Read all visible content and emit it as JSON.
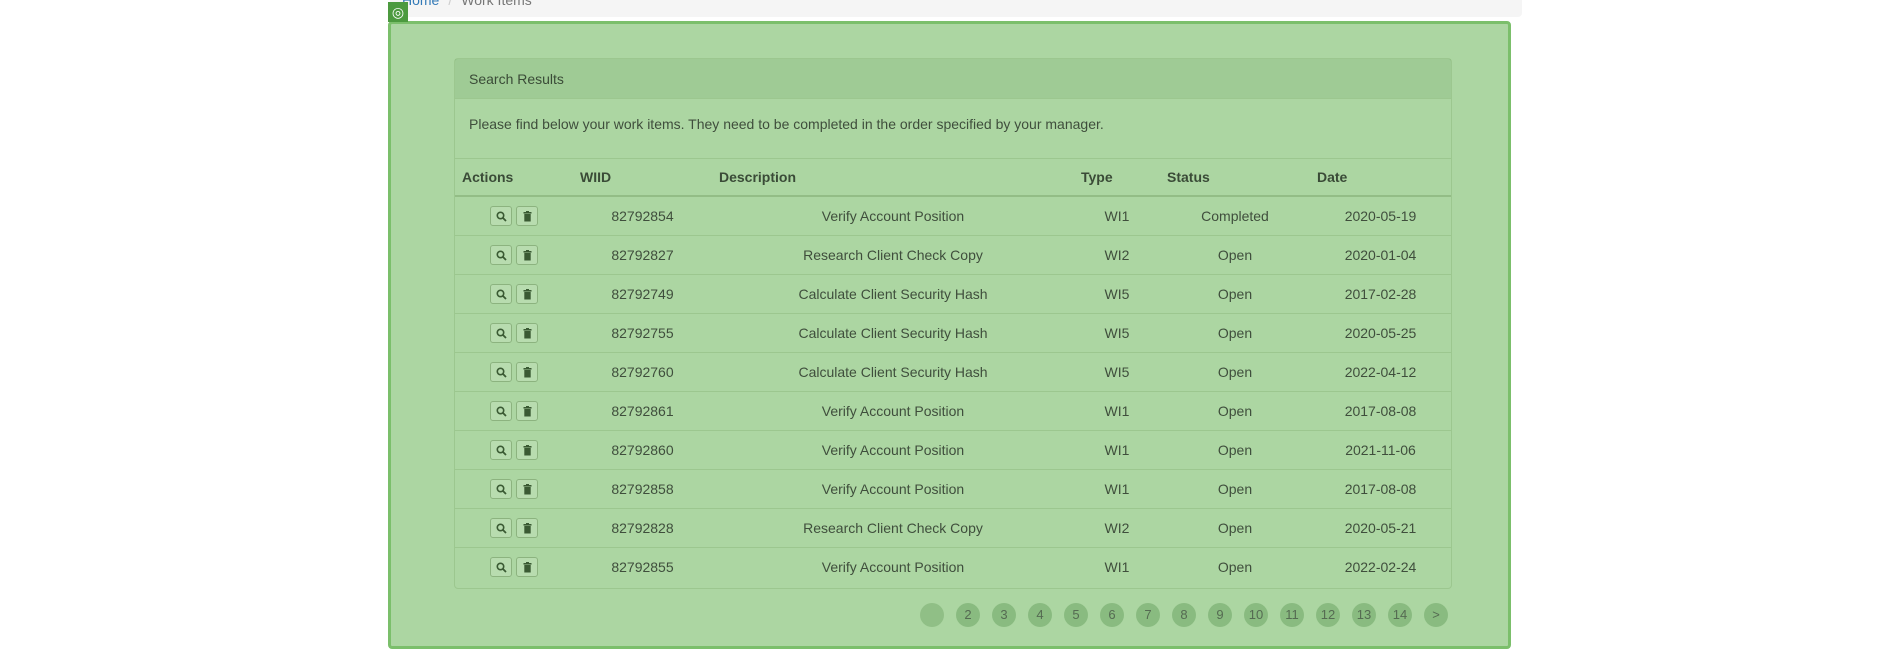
{
  "breadcrumb": {
    "home": "Home",
    "separator": "/",
    "current": "Work Items"
  },
  "overlay": {
    "badge_icon": "target-icon",
    "color": "#7bbf6b"
  },
  "panel": {
    "heading": "Search Results",
    "description": "Please find below your work items. They need to be completed in the order specified by your manager."
  },
  "table": {
    "columns": [
      "Actions",
      "WIID",
      "Description",
      "Type",
      "Status",
      "Date"
    ],
    "rows": [
      {
        "wiid": "82792854",
        "description": "Verify Account Position",
        "type": "WI1",
        "status": "Completed",
        "date": "2020-05-19"
      },
      {
        "wiid": "82792827",
        "description": "Research Client Check Copy",
        "type": "WI2",
        "status": "Open",
        "date": "2020-01-04"
      },
      {
        "wiid": "82792749",
        "description": "Calculate Client Security Hash",
        "type": "WI5",
        "status": "Open",
        "date": "2017-02-28"
      },
      {
        "wiid": "82792755",
        "description": "Calculate Client Security Hash",
        "type": "WI5",
        "status": "Open",
        "date": "2020-05-25"
      },
      {
        "wiid": "82792760",
        "description": "Calculate Client Security Hash",
        "type": "WI5",
        "status": "Open",
        "date": "2022-04-12"
      },
      {
        "wiid": "82792861",
        "description": "Verify Account Position",
        "type": "WI1",
        "status": "Open",
        "date": "2017-08-08"
      },
      {
        "wiid": "82792860",
        "description": "Verify Account Position",
        "type": "WI1",
        "status": "Open",
        "date": "2021-11-06"
      },
      {
        "wiid": "82792858",
        "description": "Verify Account Position",
        "type": "WI1",
        "status": "Open",
        "date": "2017-08-08"
      },
      {
        "wiid": "82792828",
        "description": "Research Client Check Copy",
        "type": "WI2",
        "status": "Open",
        "date": "2020-05-21"
      },
      {
        "wiid": "82792855",
        "description": "Verify Account Position",
        "type": "WI1",
        "status": "Open",
        "date": "2022-02-24"
      }
    ],
    "row_actions": {
      "view_icon": "search-icon",
      "delete_icon": "trash-icon"
    }
  },
  "pagination": {
    "prev": "<",
    "pages": [
      "2",
      "3",
      "4",
      "5",
      "6",
      "7",
      "8",
      "9",
      "10",
      "11",
      "12",
      "13",
      "14"
    ],
    "next": ">"
  }
}
